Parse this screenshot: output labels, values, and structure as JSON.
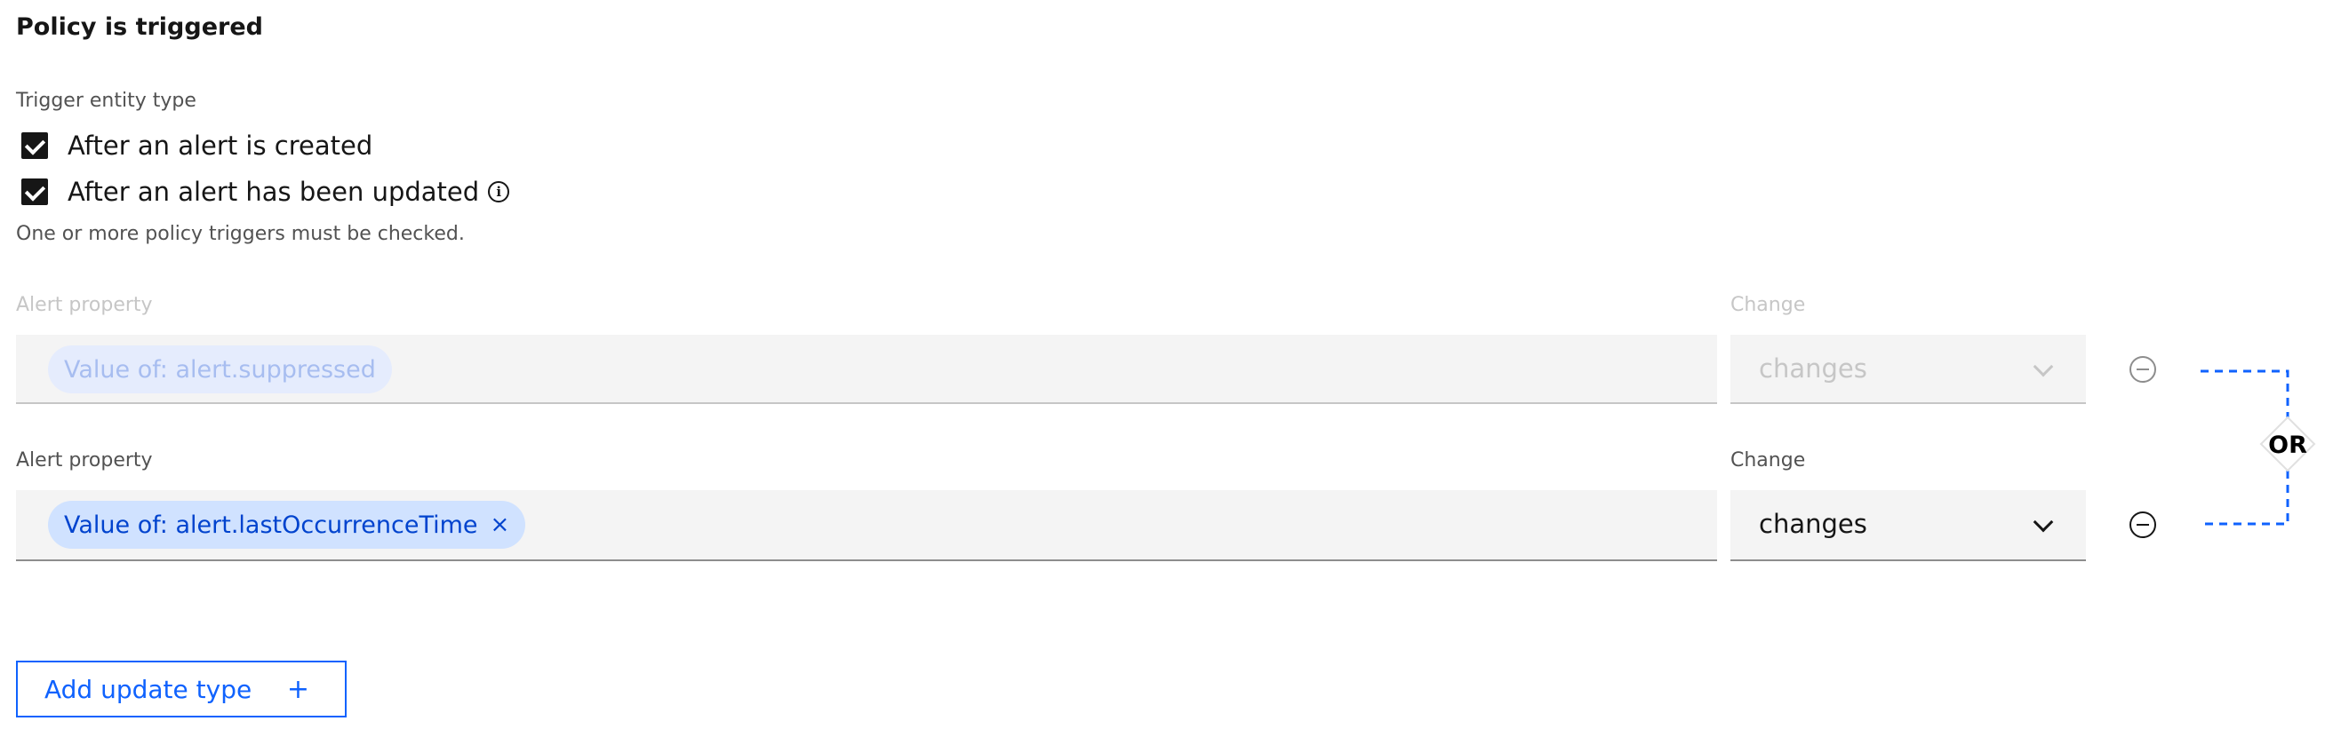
{
  "section": {
    "title": "Policy is triggered"
  },
  "trigger": {
    "label": "Trigger entity type",
    "options": [
      {
        "label": "After an alert is created",
        "checked": true
      },
      {
        "label": "After an alert has been updated",
        "checked": true,
        "info_icon": "info-icon"
      }
    ],
    "helper": "One or more policy triggers must be checked."
  },
  "conditions": [
    {
      "property_label": "Alert property",
      "property_tag": "Value of: alert.suppressed",
      "change_label": "Change",
      "change_value": "changes",
      "disabled": true
    },
    {
      "property_label": "Alert property",
      "property_tag": "Value of: alert.lastOccurrenceTime",
      "tag_close": "×",
      "change_label": "Change",
      "change_value": "changes",
      "disabled": false
    }
  ],
  "connector": {
    "label": "OR",
    "color": "#0f62fe"
  },
  "add_button": {
    "label": "Add update type",
    "icon": "+"
  }
}
